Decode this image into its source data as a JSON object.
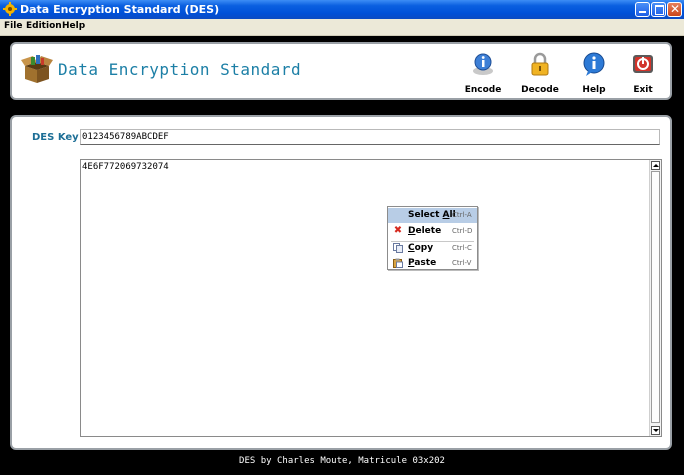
{
  "window": {
    "title": "Data Encryption Standard (DES)",
    "controls": [
      "minimize-icon",
      "maximize-icon",
      "close-icon"
    ]
  },
  "menubar": {
    "items": [
      "File",
      "Edition",
      "Help"
    ]
  },
  "header": {
    "app_title": "Data Encryption Standard",
    "logo_icon": "open-box-icon",
    "tools": [
      {
        "label": "Encode",
        "icon": "info-lightbulb-icon"
      },
      {
        "label": "Decode",
        "icon": "padlock-icon"
      },
      {
        "label": "Help",
        "icon": "help-info-icon"
      },
      {
        "label": "Exit",
        "icon": "exit-icon"
      }
    ]
  },
  "form": {
    "key_label": "DES Key :",
    "key_value": "0123456789ABCDEF",
    "text_value": "4E6F772069732074"
  },
  "context_menu": {
    "items": [
      {
        "label": "Select All",
        "shortcut": "Ctrl-A",
        "icon": "",
        "selected": true
      },
      {
        "label": "Delete",
        "shortcut": "Ctrl-D",
        "icon": "red-x-icon"
      },
      {
        "label": "Copy",
        "shortcut": "Ctrl-C",
        "icon": "copy-icon"
      },
      {
        "label": "Paste",
        "shortcut": "Ctrl-V",
        "icon": "paste-icon"
      }
    ]
  },
  "footer": {
    "text": "DES by Charles Moute, Matricule 03x202"
  },
  "colors": {
    "titlebar": "#0a5fe0",
    "accent_text": "#1c7fa6",
    "menu_selection": "#b8cde6",
    "background": "#000000"
  }
}
